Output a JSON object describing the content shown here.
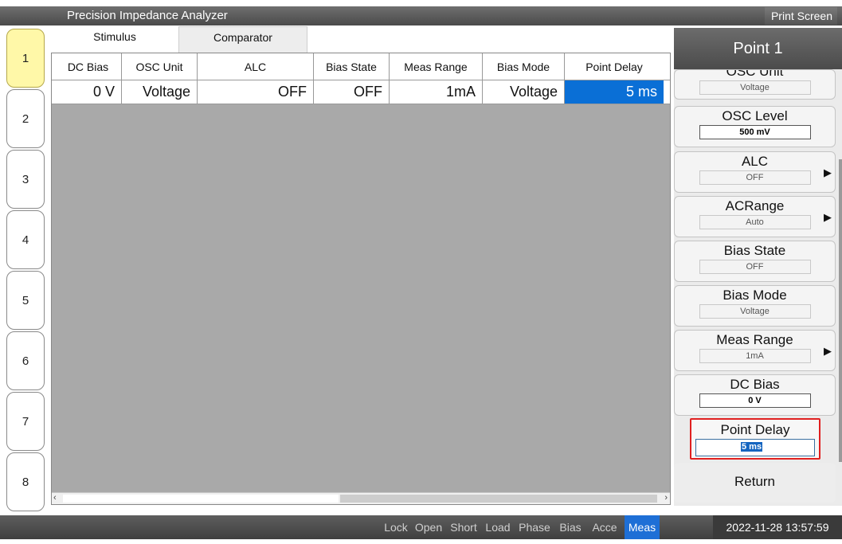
{
  "titlebar": {
    "title": "Precision Impedance Analyzer",
    "print_label": "Print Screen"
  },
  "side_tabs": [
    {
      "label": "1",
      "active": true
    },
    {
      "label": "2"
    },
    {
      "label": "3"
    },
    {
      "label": "4"
    },
    {
      "label": "5"
    },
    {
      "label": "6"
    },
    {
      "label": "7"
    },
    {
      "label": "8"
    }
  ],
  "subtabs": [
    {
      "label": "Stimulus",
      "active": true
    },
    {
      "label": "Comparator"
    }
  ],
  "table": {
    "row_stub": "»",
    "columns": [
      "DC Bias",
      "OSC Unit",
      "ALC",
      "Bias State",
      "Meas Range",
      "Bias Mode",
      "Point Delay"
    ],
    "row": [
      "0 V",
      "Voltage",
      "OFF",
      "OFF",
      "1mA",
      "Voltage",
      "5 ms"
    ],
    "selected_column": "Point Delay"
  },
  "panel": {
    "title": "Point 1",
    "partial_key": {
      "label": "OSC Unit",
      "value": "Voltage"
    },
    "keys": [
      {
        "label": "OSC Level",
        "value": "500 mV"
      },
      {
        "label": "ALC",
        "value": "OFF"
      },
      {
        "label": "ACRange",
        "value": "Auto"
      },
      {
        "label": "Bias State",
        "value": "OFF"
      },
      {
        "label": "Bias Mode",
        "value": "Voltage"
      },
      {
        "label": "Meas Range",
        "value": "1mA"
      },
      {
        "label": "DC Bias",
        "value": "0 V"
      },
      {
        "label": "Point Delay",
        "value": "5 ms"
      }
    ],
    "return_label": "Return",
    "arrow_glyph": "▶"
  },
  "statusbar": {
    "items": [
      "Lock",
      "Open",
      "Short",
      "Load",
      "Phase",
      "Bias",
      "Acce",
      "Meas"
    ],
    "active_item": "Meas",
    "datetime": "2022-11-28 13:57:59"
  },
  "colors": {
    "selected": "#0a6fd6",
    "active_tab": "#fff8a8",
    "highlight_border": "#e02020"
  }
}
